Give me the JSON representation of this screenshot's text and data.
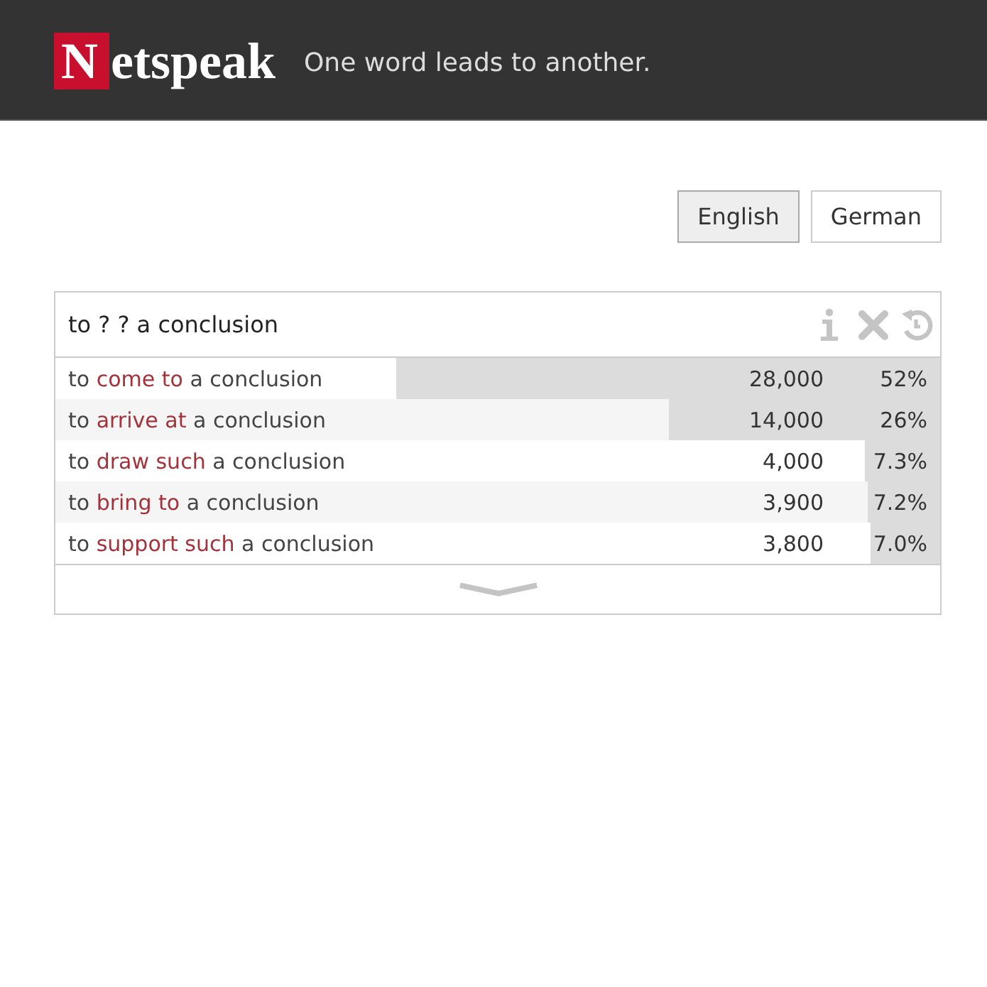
{
  "header": {
    "logo": "Netspeak",
    "tagline": "One word leads to another."
  },
  "languages": [
    {
      "label": "English",
      "selected": true
    },
    {
      "label": "German",
      "selected": false
    }
  ],
  "search": {
    "value": "to ? ? a conclusion"
  },
  "results": [
    {
      "phrase": [
        {
          "text": "to ",
          "kind": "query"
        },
        {
          "text": "come to",
          "kind": "match"
        },
        {
          "text": " a conclusion",
          "kind": "query"
        }
      ],
      "count": "28,000",
      "percent": "52%",
      "level": 0.614
    },
    {
      "phrase": [
        {
          "text": "to ",
          "kind": "query"
        },
        {
          "text": "arrive at",
          "kind": "match"
        },
        {
          "text": " a conclusion",
          "kind": "query"
        }
      ],
      "count": "14,000",
      "percent": "26%",
      "level": 0.307
    },
    {
      "phrase": [
        {
          "text": "to ",
          "kind": "query"
        },
        {
          "text": "draw such",
          "kind": "match"
        },
        {
          "text": " a conclusion",
          "kind": "query"
        }
      ],
      "count": "4,000",
      "percent": "7.3%",
      "level": 0.085
    },
    {
      "phrase": [
        {
          "text": "to ",
          "kind": "query"
        },
        {
          "text": "bring to",
          "kind": "match"
        },
        {
          "text": " a conclusion",
          "kind": "query"
        }
      ],
      "count": "3,900",
      "percent": "7.2%",
      "level": 0.082
    },
    {
      "phrase": [
        {
          "text": "to ",
          "kind": "query"
        },
        {
          "text": "support such",
          "kind": "match"
        },
        {
          "text": " a conclusion",
          "kind": "query"
        }
      ],
      "count": "3,800",
      "percent": "7.0%",
      "level": 0.079
    }
  ]
}
